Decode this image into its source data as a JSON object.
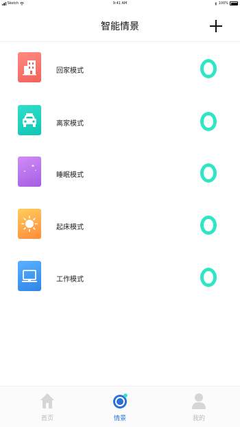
{
  "status_bar": {
    "carrier": "Sketch",
    "time": "9:41 AM",
    "battery": "100%"
  },
  "header": {
    "title": "智能情景",
    "add_icon": "plus-icon"
  },
  "modes": [
    {
      "label": "回家模式",
      "icon": "building-icon",
      "toggle_on": true
    },
    {
      "label": "离家模式",
      "icon": "car-icon",
      "toggle_on": true
    },
    {
      "label": "睡眠模式",
      "icon": "moon-icon",
      "toggle_on": true
    },
    {
      "label": "起床模式",
      "icon": "sun-icon",
      "toggle_on": true
    },
    {
      "label": "工作模式",
      "icon": "monitor-icon",
      "toggle_on": true
    }
  ],
  "colors": {
    "toggle": "#2ee6c6",
    "tab_active": "#2b6fdc",
    "tab_inactive": "#b8b8b8"
  },
  "tabs": [
    {
      "label": "首页",
      "icon": "home-icon",
      "active": false
    },
    {
      "label": "情景",
      "icon": "scene-icon",
      "active": true
    },
    {
      "label": "我的",
      "icon": "user-icon",
      "active": false
    }
  ]
}
